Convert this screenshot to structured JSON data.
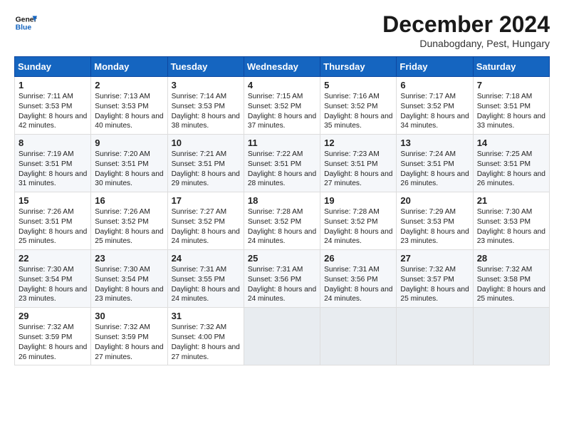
{
  "header": {
    "logo_line1": "General",
    "logo_line2": "Blue",
    "month": "December 2024",
    "location": "Dunabogdany, Pest, Hungary"
  },
  "columns": [
    "Sunday",
    "Monday",
    "Tuesday",
    "Wednesday",
    "Thursday",
    "Friday",
    "Saturday"
  ],
  "weeks": [
    [
      {
        "day": "1",
        "text": "Sunrise: 7:11 AM\nSunset: 3:53 PM\nDaylight: 8 hours and 42 minutes."
      },
      {
        "day": "2",
        "text": "Sunrise: 7:13 AM\nSunset: 3:53 PM\nDaylight: 8 hours and 40 minutes."
      },
      {
        "day": "3",
        "text": "Sunrise: 7:14 AM\nSunset: 3:53 PM\nDaylight: 8 hours and 38 minutes."
      },
      {
        "day": "4",
        "text": "Sunrise: 7:15 AM\nSunset: 3:52 PM\nDaylight: 8 hours and 37 minutes."
      },
      {
        "day": "5",
        "text": "Sunrise: 7:16 AM\nSunset: 3:52 PM\nDaylight: 8 hours and 35 minutes."
      },
      {
        "day": "6",
        "text": "Sunrise: 7:17 AM\nSunset: 3:52 PM\nDaylight: 8 hours and 34 minutes."
      },
      {
        "day": "7",
        "text": "Sunrise: 7:18 AM\nSunset: 3:51 PM\nDaylight: 8 hours and 33 minutes."
      }
    ],
    [
      {
        "day": "8",
        "text": "Sunrise: 7:19 AM\nSunset: 3:51 PM\nDaylight: 8 hours and 31 minutes."
      },
      {
        "day": "9",
        "text": "Sunrise: 7:20 AM\nSunset: 3:51 PM\nDaylight: 8 hours and 30 minutes."
      },
      {
        "day": "10",
        "text": "Sunrise: 7:21 AM\nSunset: 3:51 PM\nDaylight: 8 hours and 29 minutes."
      },
      {
        "day": "11",
        "text": "Sunrise: 7:22 AM\nSunset: 3:51 PM\nDaylight: 8 hours and 28 minutes."
      },
      {
        "day": "12",
        "text": "Sunrise: 7:23 AM\nSunset: 3:51 PM\nDaylight: 8 hours and 27 minutes."
      },
      {
        "day": "13",
        "text": "Sunrise: 7:24 AM\nSunset: 3:51 PM\nDaylight: 8 hours and 26 minutes."
      },
      {
        "day": "14",
        "text": "Sunrise: 7:25 AM\nSunset: 3:51 PM\nDaylight: 8 hours and 26 minutes."
      }
    ],
    [
      {
        "day": "15",
        "text": "Sunrise: 7:26 AM\nSunset: 3:51 PM\nDaylight: 8 hours and 25 minutes."
      },
      {
        "day": "16",
        "text": "Sunrise: 7:26 AM\nSunset: 3:52 PM\nDaylight: 8 hours and 25 minutes."
      },
      {
        "day": "17",
        "text": "Sunrise: 7:27 AM\nSunset: 3:52 PM\nDaylight: 8 hours and 24 minutes."
      },
      {
        "day": "18",
        "text": "Sunrise: 7:28 AM\nSunset: 3:52 PM\nDaylight: 8 hours and 24 minutes."
      },
      {
        "day": "19",
        "text": "Sunrise: 7:28 AM\nSunset: 3:52 PM\nDaylight: 8 hours and 24 minutes."
      },
      {
        "day": "20",
        "text": "Sunrise: 7:29 AM\nSunset: 3:53 PM\nDaylight: 8 hours and 23 minutes."
      },
      {
        "day": "21",
        "text": "Sunrise: 7:30 AM\nSunset: 3:53 PM\nDaylight: 8 hours and 23 minutes."
      }
    ],
    [
      {
        "day": "22",
        "text": "Sunrise: 7:30 AM\nSunset: 3:54 PM\nDaylight: 8 hours and 23 minutes."
      },
      {
        "day": "23",
        "text": "Sunrise: 7:30 AM\nSunset: 3:54 PM\nDaylight: 8 hours and 23 minutes."
      },
      {
        "day": "24",
        "text": "Sunrise: 7:31 AM\nSunset: 3:55 PM\nDaylight: 8 hours and 24 minutes."
      },
      {
        "day": "25",
        "text": "Sunrise: 7:31 AM\nSunset: 3:56 PM\nDaylight: 8 hours and 24 minutes."
      },
      {
        "day": "26",
        "text": "Sunrise: 7:31 AM\nSunset: 3:56 PM\nDaylight: 8 hours and 24 minutes."
      },
      {
        "day": "27",
        "text": "Sunrise: 7:32 AM\nSunset: 3:57 PM\nDaylight: 8 hours and 25 minutes."
      },
      {
        "day": "28",
        "text": "Sunrise: 7:32 AM\nSunset: 3:58 PM\nDaylight: 8 hours and 25 minutes."
      }
    ],
    [
      {
        "day": "29",
        "text": "Sunrise: 7:32 AM\nSunset: 3:59 PM\nDaylight: 8 hours and 26 minutes."
      },
      {
        "day": "30",
        "text": "Sunrise: 7:32 AM\nSunset: 3:59 PM\nDaylight: 8 hours and 27 minutes."
      },
      {
        "day": "31",
        "text": "Sunrise: 7:32 AM\nSunset: 4:00 PM\nDaylight: 8 hours and 27 minutes."
      },
      {
        "day": "",
        "text": ""
      },
      {
        "day": "",
        "text": ""
      },
      {
        "day": "",
        "text": ""
      },
      {
        "day": "",
        "text": ""
      }
    ]
  ]
}
